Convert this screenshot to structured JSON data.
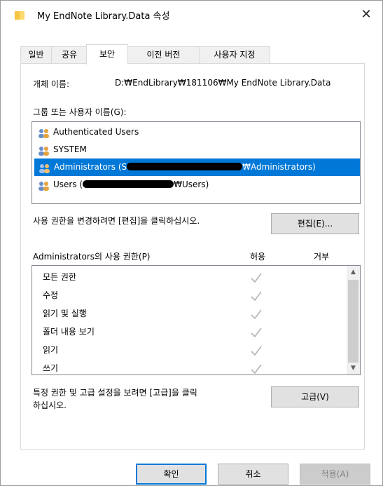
{
  "window": {
    "title": "My EndNote Library.Data 속성",
    "close_glyph": "✕"
  },
  "tabs": [
    {
      "label": "일반",
      "active": false
    },
    {
      "label": "공유",
      "active": false
    },
    {
      "label": "보안",
      "active": true
    },
    {
      "label": "이전 버전",
      "active": false
    },
    {
      "label": "사용자 지정",
      "active": false
    }
  ],
  "object": {
    "label": "개체 이름:",
    "value": "D:₩EndLibrary₩181106₩My EndNote Library.Data"
  },
  "group_section": {
    "label": "그룹 또는 사용자 이름(G):"
  },
  "users": [
    {
      "name": "Authenticated Users",
      "suffix": "",
      "icon": "users-group-icon",
      "selected": false
    },
    {
      "name": "SYSTEM",
      "suffix": "",
      "icon": "users-group-icon",
      "selected": false
    },
    {
      "name": "Administrators (S",
      "suffix": "₩Administrators)",
      "icon": "users-group-icon",
      "selected": true
    },
    {
      "name": "Users (",
      "suffix": "₩Users)",
      "icon": "users-group-icon",
      "selected": false
    }
  ],
  "change_perm": {
    "text": "사용 권한을 변경하려면 [편집]을 클릭하십시오.",
    "edit_button": "편집(E)..."
  },
  "permissions": {
    "header": "Administrators의 사용 권한(P)",
    "allow_label": "허용",
    "deny_label": "거부",
    "rows": [
      {
        "name": "모든 권한",
        "allow": true,
        "deny": false
      },
      {
        "name": "수정",
        "allow": true,
        "deny": false
      },
      {
        "name": "읽기 및 실행",
        "allow": true,
        "deny": false
      },
      {
        "name": "폴더 내용 보기",
        "allow": true,
        "deny": false
      },
      {
        "name": "읽기",
        "allow": true,
        "deny": false
      },
      {
        "name": "쓰기",
        "allow": true,
        "deny": false
      }
    ]
  },
  "advanced": {
    "text_line1": "특정 권한 및 고급 설정을 보려면 [고급]을 클릭",
    "text_line2": "하십시오.",
    "button": "고급(V)"
  },
  "footer": {
    "ok": "확인",
    "cancel": "취소",
    "apply": "적용(A)"
  },
  "colors": {
    "selection": "#0078d7",
    "checkmark": "#b4b4b4"
  }
}
